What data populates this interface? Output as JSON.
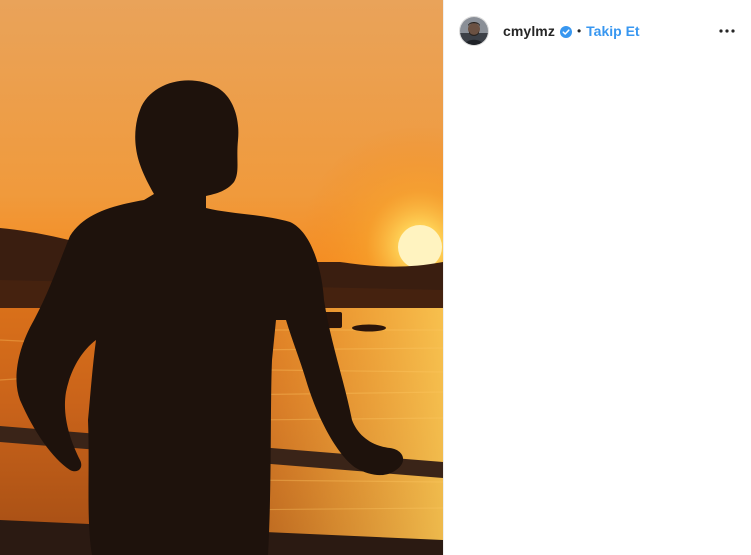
{
  "post": {
    "image": {
      "description_icon": "photo-image"
    },
    "header": {
      "username": "cmylmz",
      "separator": "•",
      "follow_label": "Takip Et",
      "verified_icon": "verified-badge-icon",
      "more_icon": "more-options-icon"
    },
    "colors": {
      "accent": "#3897f0",
      "text": "#262626"
    }
  }
}
